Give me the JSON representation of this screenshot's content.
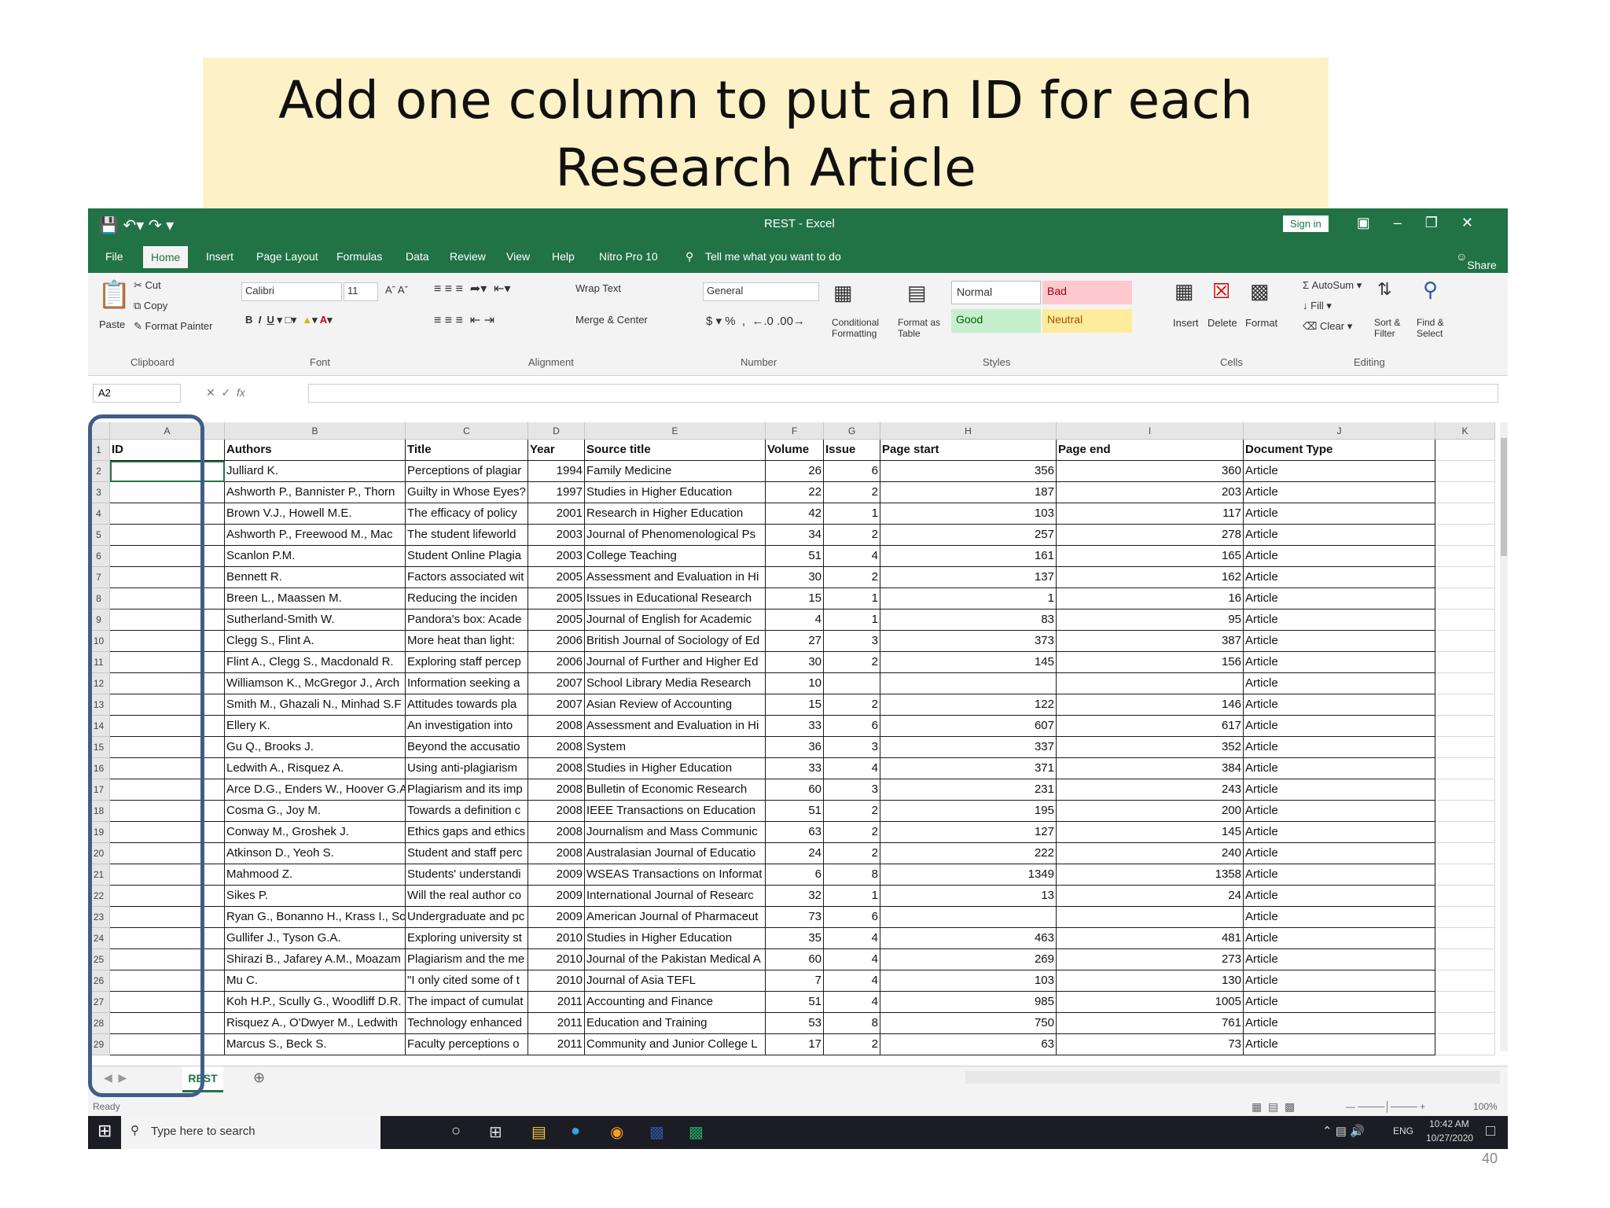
{
  "slide": {
    "title_line1": "Add one column to put an ID for each",
    "title_line2": "Research Article",
    "page_number": "40"
  },
  "excel": {
    "window_title": "REST - Excel",
    "sign_in": "Sign in",
    "menu": [
      "File",
      "Home",
      "Insert",
      "Page Layout",
      "Formulas",
      "Data",
      "Review",
      "View",
      "Help",
      "Nitro Pro 10"
    ],
    "tell_me": "Tell me what you want to do",
    "share": "Share",
    "ribbon": {
      "paste": "Paste",
      "cut": "Cut",
      "copy": "Copy",
      "format_painter": "Format Painter",
      "clipboard": "Clipboard",
      "font_name": "Calibri",
      "font_size": "11",
      "font_group": "Font",
      "wrap_text": "Wrap Text",
      "merge_center": "Merge & Center",
      "alignment_group": "Alignment",
      "number_format": "General",
      "number_group": "Number",
      "conditional_formatting": "Conditional Formatting",
      "format_as_table": "Format as Table",
      "style_normal": "Normal",
      "style_bad": "Bad",
      "style_good": "Good",
      "style_neutral": "Neutral",
      "styles_group": "Styles",
      "insert": "Insert",
      "delete": "Delete",
      "format": "Format",
      "cells_group": "Cells",
      "autosum": "AutoSum",
      "fill": "Fill",
      "clear": "Clear",
      "sort_filter": "Sort & Filter",
      "find_select": "Find & Select",
      "editing_group": "Editing"
    },
    "name_box": "A2",
    "column_letters": [
      "A",
      "B",
      "C",
      "D",
      "E",
      "F",
      "G",
      "H",
      "I",
      "J",
      "K"
    ],
    "headers": [
      "ID",
      "Authors",
      "Title",
      "Year",
      "Source title",
      "Volume",
      "Issue",
      "Page start",
      "Page end",
      "Document Type"
    ],
    "rows": [
      [
        "",
        "Julliard K.",
        "Perceptions of plagiar",
        "1994",
        "Family Medicine",
        "26",
        "6",
        "356",
        "360",
        "Article"
      ],
      [
        "",
        "Ashworth P., Bannister P., Thorn",
        "Guilty in Whose Eyes?",
        "1997",
        "Studies in Higher Education",
        "22",
        "2",
        "187",
        "203",
        "Article"
      ],
      [
        "",
        "Brown V.J., Howell M.E.",
        "The efficacy of policy",
        "2001",
        "Research in Higher Education",
        "42",
        "1",
        "103",
        "117",
        "Article"
      ],
      [
        "",
        "Ashworth P., Freewood M., Mac",
        "The student lifeworld",
        "2003",
        "Journal of Phenomenological Ps",
        "34",
        "2",
        "257",
        "278",
        "Article"
      ],
      [
        "",
        "Scanlon P.M.",
        "Student Online Plagia",
        "2003",
        "College Teaching",
        "51",
        "4",
        "161",
        "165",
        "Article"
      ],
      [
        "",
        "Bennett R.",
        "Factors associated wit",
        "2005",
        "Assessment and Evaluation in Hi",
        "30",
        "2",
        "137",
        "162",
        "Article"
      ],
      [
        "",
        "Breen L., Maassen M.",
        "Reducing the inciden",
        "2005",
        "Issues in Educational Research",
        "15",
        "1",
        "1",
        "16",
        "Article"
      ],
      [
        "",
        "Sutherland-Smith W.",
        "Pandora's box: Acade",
        "2005",
        "Journal of English for Academic",
        "4",
        "1",
        "83",
        "95",
        "Article"
      ],
      [
        "",
        "Clegg S., Flint A.",
        "More heat than light:",
        "2006",
        "British Journal of Sociology of Ed",
        "27",
        "3",
        "373",
        "387",
        "Article"
      ],
      [
        "",
        "Flint A., Clegg S., Macdonald R.",
        "Exploring staff percep",
        "2006",
        "Journal of Further and Higher Ed",
        "30",
        "2",
        "145",
        "156",
        "Article"
      ],
      [
        "",
        "Williamson K., McGregor J., Arch",
        "Information seeking a",
        "2007",
        "School Library Media Research",
        "10",
        "",
        "",
        "",
        "Article"
      ],
      [
        "",
        "Smith M., Ghazali N., Minhad S.F",
        "Attitudes towards pla",
        "2007",
        "Asian Review of Accounting",
        "15",
        "2",
        "122",
        "146",
        "Article"
      ],
      [
        "",
        "Ellery K.",
        "An investigation into",
        "2008",
        "Assessment and Evaluation in Hi",
        "33",
        "6",
        "607",
        "617",
        "Article"
      ],
      [
        "",
        "Gu Q., Brooks J.",
        "Beyond the accusatio",
        "2008",
        "System",
        "36",
        "3",
        "337",
        "352",
        "Article"
      ],
      [
        "",
        "Ledwith A., Risquez A.",
        "Using anti-plagiarism",
        "2008",
        "Studies in Higher Education",
        "33",
        "4",
        "371",
        "384",
        "Article"
      ],
      [
        "",
        "Arce D.G., Enders W., Hoover G.A",
        "Plagiarism and its imp",
        "2008",
        "Bulletin of Economic Research",
        "60",
        "3",
        "231",
        "243",
        "Article"
      ],
      [
        "",
        "Cosma G., Joy M.",
        "Towards a definition c",
        "2008",
        "IEEE Transactions on Education",
        "51",
        "2",
        "195",
        "200",
        "Article"
      ],
      [
        "",
        "Conway M., Groshek J.",
        "Ethics gaps and ethics",
        "2008",
        "Journalism and Mass Communic",
        "63",
        "2",
        "127",
        "145",
        "Article"
      ],
      [
        "",
        "Atkinson D., Yeoh S.",
        "Student and staff perc",
        "2008",
        "Australasian Journal of Educatio",
        "24",
        "2",
        "222",
        "240",
        "Article"
      ],
      [
        "",
        "Mahmood Z.",
        "Students' understandi",
        "2009",
        "WSEAS Transactions on Informat",
        "6",
        "8",
        "1349",
        "1358",
        "Article"
      ],
      [
        "",
        "Sikes P.",
        "Will the real author co",
        "2009",
        "International Journal of Researc",
        "32",
        "1",
        "13",
        "24",
        "Article"
      ],
      [
        "",
        "Ryan G., Bonanno H., Krass I., Sc",
        "Undergraduate and pc",
        "2009",
        "American Journal of Pharmaceut",
        "73",
        "6",
        "",
        "",
        "Article"
      ],
      [
        "",
        "Gullifer J., Tyson G.A.",
        "Exploring university st",
        "2010",
        "Studies in Higher Education",
        "35",
        "4",
        "463",
        "481",
        "Article"
      ],
      [
        "",
        "Shirazi B., Jafarey A.M., Moazam",
        "Plagiarism and the me",
        "2010",
        "Journal of the Pakistan Medical A",
        "60",
        "4",
        "269",
        "273",
        "Article"
      ],
      [
        "",
        "Mu C.",
        "\"I only cited some of t",
        "2010",
        "Journal of Asia TEFL",
        "7",
        "4",
        "103",
        "130",
        "Article"
      ],
      [
        "",
        "Koh H.P., Scully G., Woodliff D.R.",
        "The impact of cumulat",
        "2011",
        "Accounting and Finance",
        "51",
        "4",
        "985",
        "1005",
        "Article"
      ],
      [
        "",
        "Risquez A., O'Dwyer M., Ledwith",
        "Technology enhanced",
        "2011",
        "Education and Training",
        "53",
        "8",
        "750",
        "761",
        "Article"
      ],
      [
        "",
        "Marcus S., Beck S.",
        "Faculty perceptions o",
        "2011",
        "Community and Junior College L",
        "17",
        "2",
        "63",
        "73",
        "Article"
      ]
    ],
    "sheet_tab": "REST",
    "zoom": "100%",
    "status": "Ready"
  },
  "taskbar": {
    "search_placeholder": "Type here to search",
    "lang": "ENG",
    "time": "10:42 AM",
    "date": "10/27/2020"
  }
}
